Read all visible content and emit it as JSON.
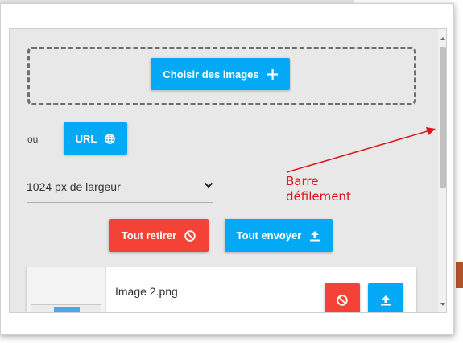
{
  "upload_panel": {
    "choose_images_label": "Choisir des images",
    "or_label": "ou",
    "url_label": "URL",
    "width_select_value": "1024 px de largeur",
    "remove_all_label": "Tout retirer",
    "send_all_label": "Tout envoyer"
  },
  "image_list": [
    {
      "file_name": "Image 2.png"
    }
  ],
  "annotation": {
    "text": "Barre\ndéfilement",
    "color": "#e0141e"
  },
  "icons": {
    "choose": "plus-icon",
    "url": "globe-icon",
    "select": "chevron-down-icon",
    "remove": "block-icon",
    "send": "upload-icon"
  },
  "colors": {
    "primary": "#03a9f4",
    "danger": "#f44336",
    "panel_bg": "#e8e8e8"
  }
}
